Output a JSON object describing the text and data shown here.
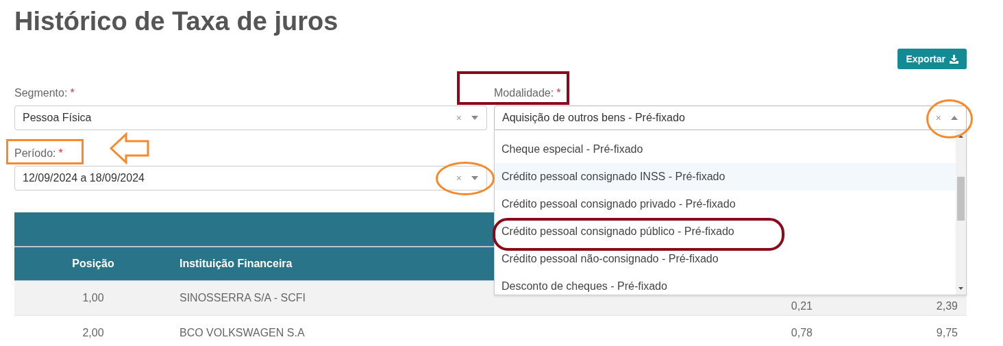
{
  "title": "Histórico de Taxa de juros",
  "export_button": {
    "label": "Exportar"
  },
  "filters": [
    {
      "label": "Segmento:",
      "required_mark": "*",
      "value": "Pessoa Física",
      "clear_icon": "×",
      "expanded": false
    },
    {
      "label": "Modalidade:",
      "required_mark": "*",
      "value": "Aquisição de outros bens - Pré-fixado",
      "clear_icon": "×",
      "expanded": true,
      "options": [
        {
          "label": "Cheque especial - Pré-fixado",
          "highlighted": false
        },
        {
          "label": "Crédito pessoal consignado INSS - Pré-fixado",
          "highlighted": true
        },
        {
          "label": "Crédito pessoal consignado privado - Pré-fixado",
          "highlighted": false
        },
        {
          "label": "Crédito pessoal consignado público - Pré-fixado",
          "highlighted": false
        },
        {
          "label": "Crédito pessoal não-consignado - Pré-fixado",
          "highlighted": false
        },
        {
          "label": "Desconto de cheques - Pré-fixado",
          "highlighted": false
        }
      ]
    },
    {
      "label": "Período:",
      "required_mark": "*",
      "value": "12/09/2024 a 18/09/2024",
      "clear_icon": "×",
      "expanded": false
    }
  ],
  "table": {
    "columns": [
      "Posição",
      "Instituição Financeira"
    ],
    "rows": [
      [
        "1,00",
        "SINOSSERRA S/A - SCFI",
        "0,21",
        "2,39"
      ],
      [
        "2,00",
        "BCO VOLKSWAGEN S.A",
        "0,78",
        "9,75"
      ]
    ]
  }
}
